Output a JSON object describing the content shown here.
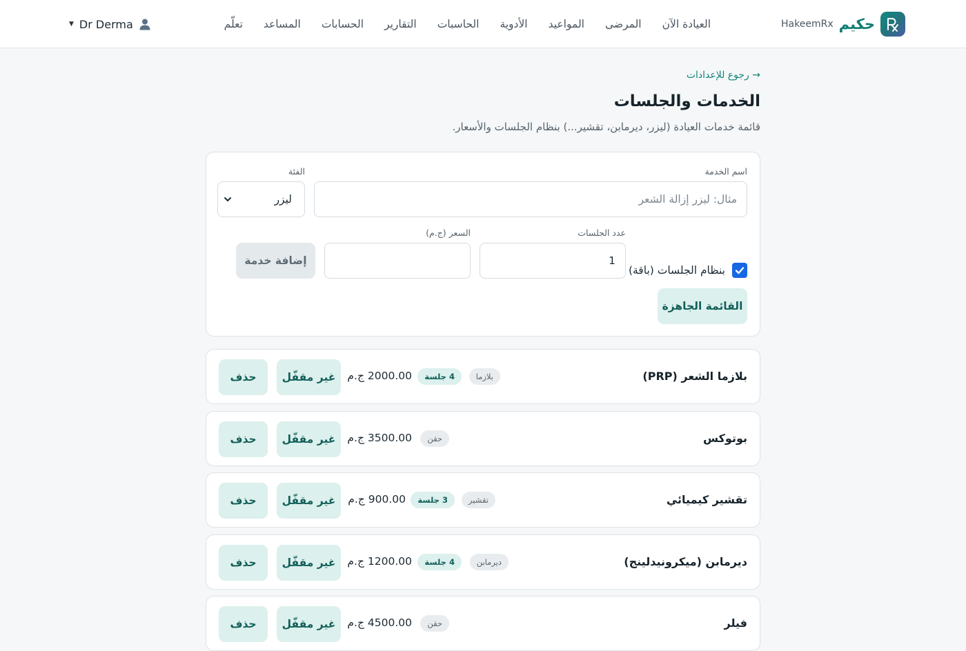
{
  "brand": {
    "name_ar": "حكيم",
    "name_en": "HakeemRx"
  },
  "nav": {
    "items": [
      "العيادة الآن",
      "المرضى",
      "المواعيد",
      "الأدوية",
      "الحاسبات",
      "التقارير",
      "الحسابات",
      "المساعد",
      "تعلّم"
    ]
  },
  "user": {
    "name": "Dr Derma"
  },
  "page": {
    "back": "→ رجوع للإعدادات",
    "title": "الخدمات والجلسات",
    "subtitle": "قائمة خدمات العيادة (ليزر، ديرمابن، تقشير...) بنظام الجلسات والأسعار."
  },
  "form": {
    "service_label": "اسم الخدمة",
    "service_placeholder": "مثال: ليزر إزالة الشعر",
    "category_label": "الفئة",
    "category_value": "ليزر",
    "sessions_label": "عدد الجلسات",
    "sessions_value": "1",
    "price_label": "السعر (ج.م)",
    "price_value": "",
    "package_label": "بنظام الجلسات (باقة)",
    "package_checked": true,
    "add_button": "إضافة خدمة",
    "ready_list_button": "القائمة الجاهزة"
  },
  "services": [
    {
      "name": "بلازما الشعر (PRP)",
      "category": "بلازما",
      "sessions": "4 جلسة",
      "price": "2000.00 ج.م",
      "lock": "غير مقفّل",
      "delete": "حذف"
    },
    {
      "name": "بوتوكس",
      "category": "حقن",
      "sessions": "",
      "price": "3500.00 ج.م",
      "lock": "غير مقفّل",
      "delete": "حذف"
    },
    {
      "name": "تقشير كيميائي",
      "category": "تقشير",
      "sessions": "3 جلسة",
      "price": "900.00 ج.م",
      "lock": "غير مقفّل",
      "delete": "حذف"
    },
    {
      "name": "ديرمابن (ميكرونيدلينج)",
      "category": "ديرمابن",
      "sessions": "4 جلسة",
      "price": "1200.00 ج.م",
      "lock": "غير مقفّل",
      "delete": "حذف"
    },
    {
      "name": "فيلر",
      "category": "حقن",
      "sessions": "",
      "price": "4500.00 ج.م",
      "lock": "غير مقفّل",
      "delete": "حذف"
    }
  ],
  "colors": {
    "accent": "#0f7d74",
    "checkbox": "#1668e3",
    "teal_button_bg": "#dcf0ed"
  }
}
